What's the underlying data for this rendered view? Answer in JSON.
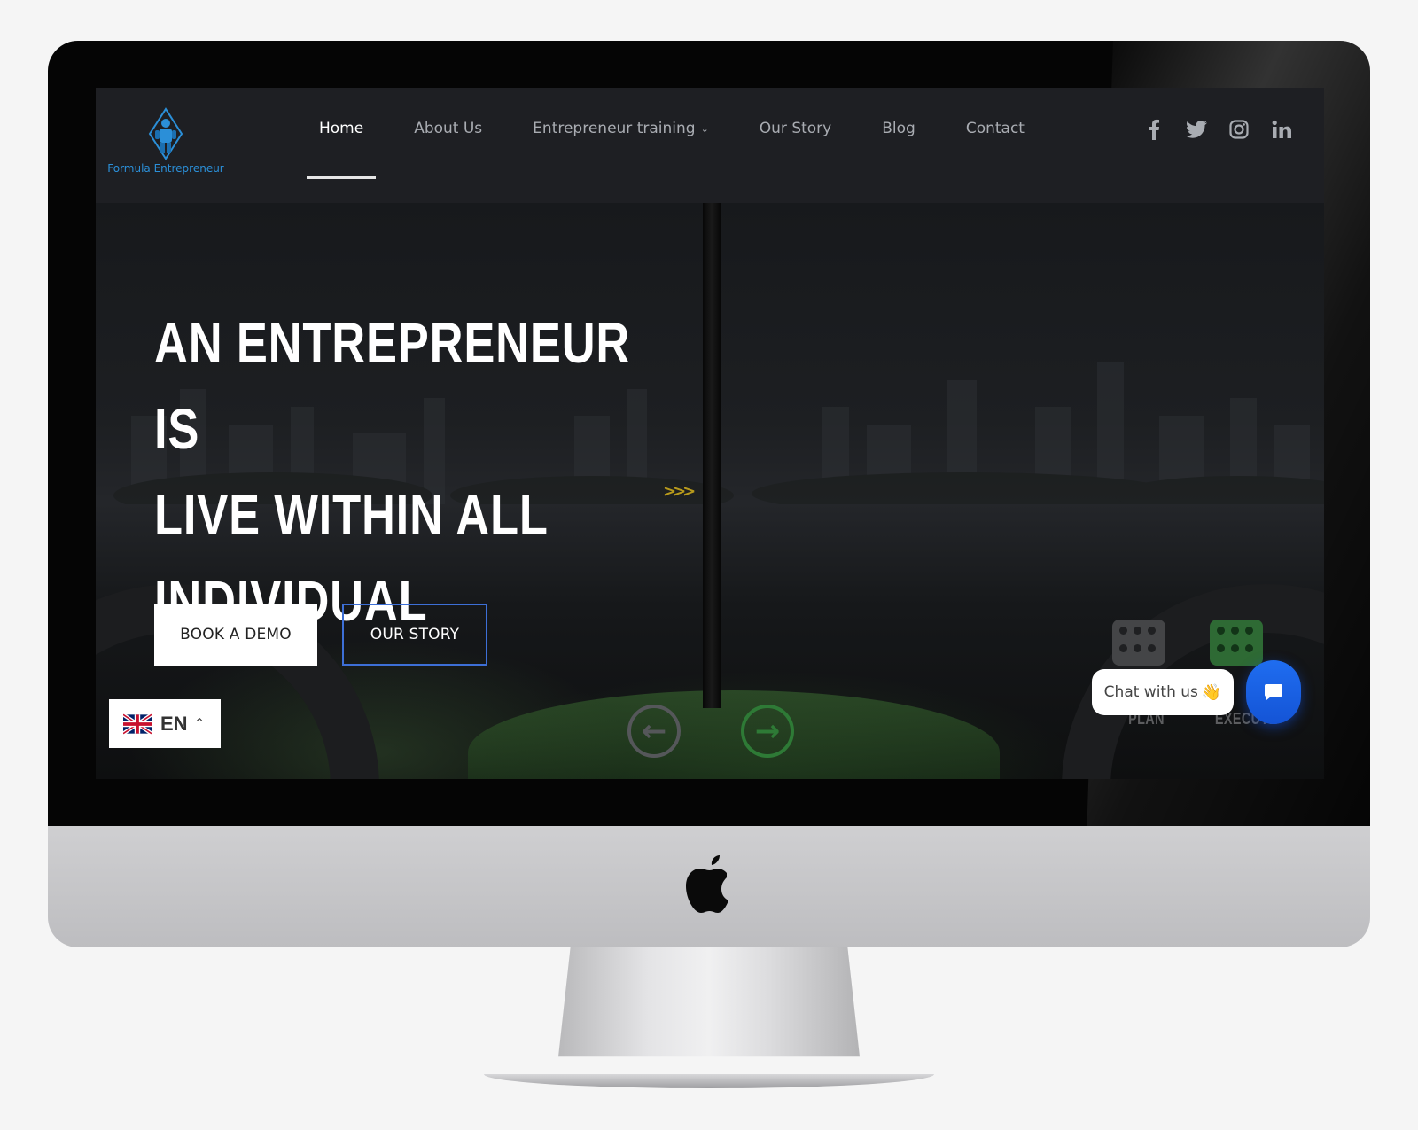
{
  "site": {
    "logo_text": "Formula Entrepreneur"
  },
  "nav": {
    "items": [
      {
        "label": "Home",
        "active": true
      },
      {
        "label": "About Us"
      },
      {
        "label": "Entrepreneur training",
        "has_dropdown": true
      },
      {
        "label": "Our Story"
      },
      {
        "label": "Blog"
      },
      {
        "label": "Contact"
      }
    ]
  },
  "social": [
    "facebook-icon",
    "twitter-icon",
    "instagram-icon",
    "linkedin-icon"
  ],
  "hero": {
    "headline_lines": [
      "AN ENTREPRENEUR IS",
      "LIVE WITHIN ALL",
      "INDIVIDUAL"
    ],
    "primary_button": "BOOK A DEMO",
    "secondary_button": "OUR STORY",
    "game_labels": {
      "plan": "PLAN",
      "execute": "EXECUTE"
    }
  },
  "language": {
    "code": "EN",
    "flag": "uk-flag"
  },
  "chat": {
    "label": "Chat with us",
    "emoji": "👋"
  },
  "colors": {
    "header_bg": "#1e1f23",
    "logo_blue": "#2b8fd8",
    "button_border": "#3d6fd6",
    "chat_blue": "#1f6df0"
  }
}
